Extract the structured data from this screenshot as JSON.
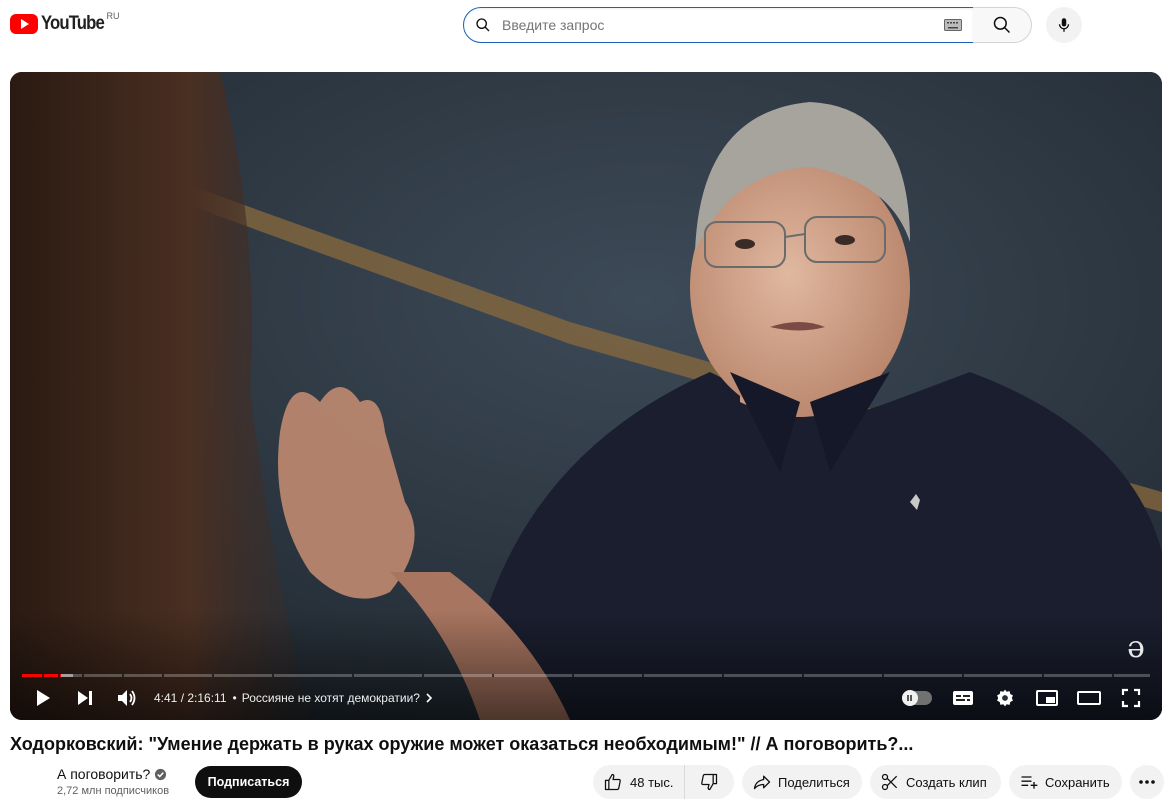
{
  "header": {
    "logo_text": "YouTube",
    "logo_country": "RU",
    "search_placeholder": "Введите запрос",
    "icons": [
      "youtube-logo-icon",
      "search-icon",
      "keyboard-icon",
      "mic-icon"
    ]
  },
  "player": {
    "current_time": "4:41",
    "duration": "2:16:11",
    "time_display": "4:41 / 2:16:11",
    "chapter_title": "Россияне не хотят демократии?",
    "progress_played_fraction": 0.035,
    "progress_loaded_fraction": 0.045,
    "watermark": "ə",
    "accent_color": "#ff0000",
    "icons": [
      "play-icon",
      "next-icon",
      "volume-icon",
      "autoplay-toggle-icon",
      "subtitles-icon",
      "settings-icon",
      "miniplayer-icon",
      "theater-icon",
      "fullscreen-icon"
    ]
  },
  "video": {
    "title": "Ходорковский: \"Умение держать в руках оружие может оказаться необходимым!\" // А поговорить?...",
    "channel_name": "А поговорить?",
    "subscribers": "2,72 млн подписчиков",
    "subscribe_label": "Подписаться"
  },
  "actions": {
    "likes": "48 тыс.",
    "share": "Поделиться",
    "clip": "Создать клип",
    "save": "Сохранить"
  }
}
